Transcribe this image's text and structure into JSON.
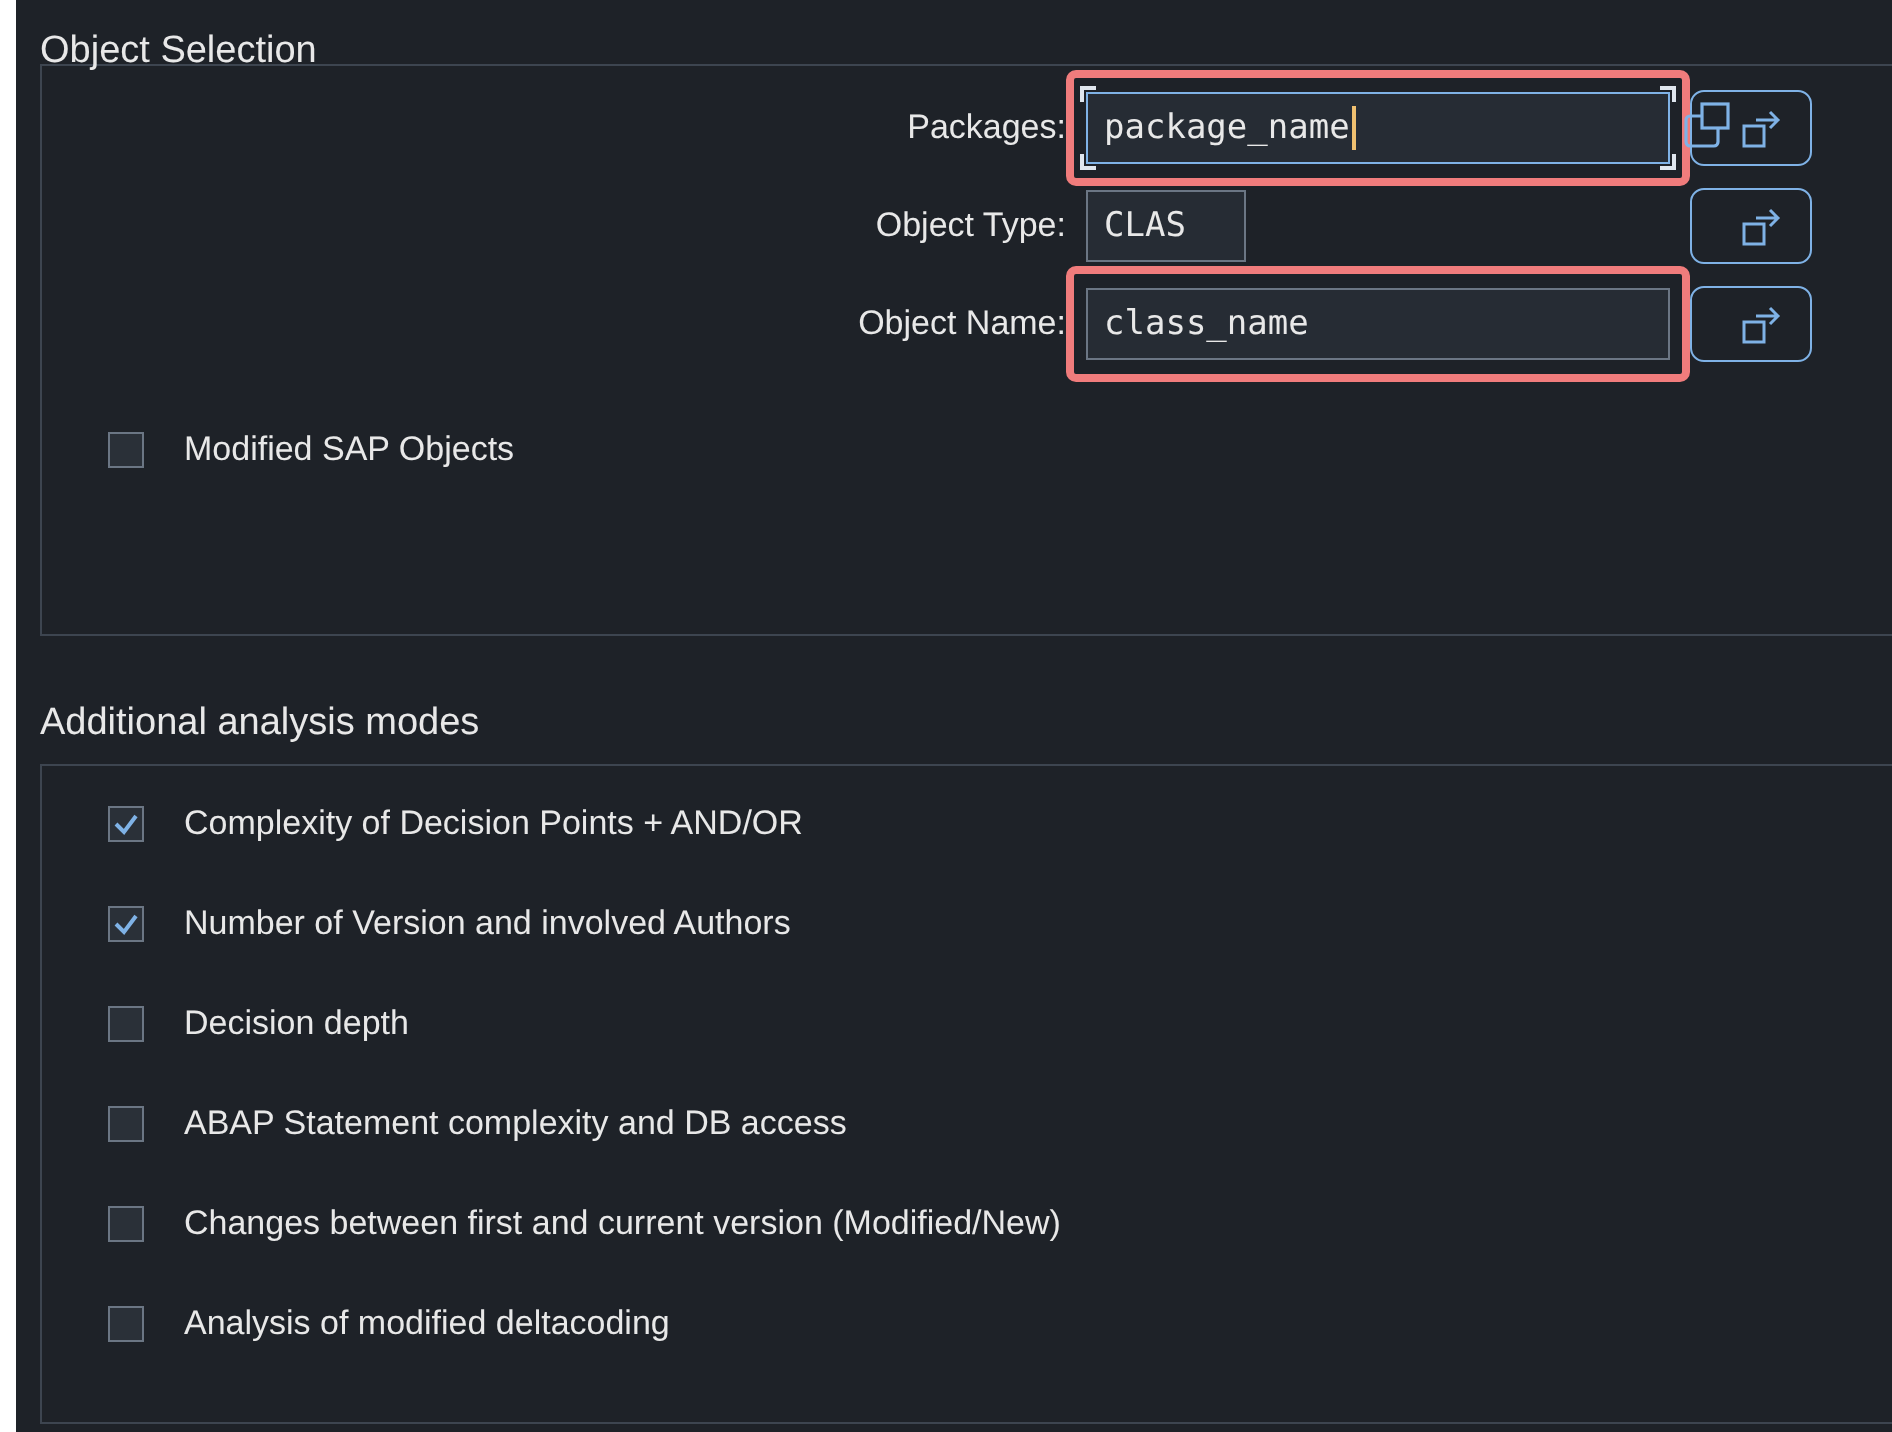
{
  "object_selection": {
    "title": "Object Selection",
    "fields": [
      {
        "label": "Packages:",
        "value": "package_name",
        "focused": true,
        "highlighted": true,
        "kind": "wide",
        "multi_select": true
      },
      {
        "label": "Object Type:",
        "value": "CLAS",
        "focused": false,
        "highlighted": false,
        "kind": "short",
        "multi_select": false
      },
      {
        "label": "Object Name:",
        "value": "class_name",
        "focused": false,
        "highlighted": true,
        "kind": "wide",
        "multi_select": false
      }
    ],
    "options": [
      {
        "label": "Modified SAP Objects",
        "checked": false
      }
    ]
  },
  "analysis_modes": {
    "title": "Additional analysis modes",
    "options": [
      {
        "label": "Complexity of Decision Points + AND/OR",
        "checked": true
      },
      {
        "label": "Number of Version and involved Authors",
        "checked": true
      },
      {
        "label": "Decision depth",
        "checked": false
      },
      {
        "label": "ABAP Statement complexity and DB access",
        "checked": false
      },
      {
        "label": "Changes between first and current version (Modified/New)",
        "checked": false
      },
      {
        "label": "Analysis of modified deltacoding",
        "checked": false
      }
    ]
  }
}
